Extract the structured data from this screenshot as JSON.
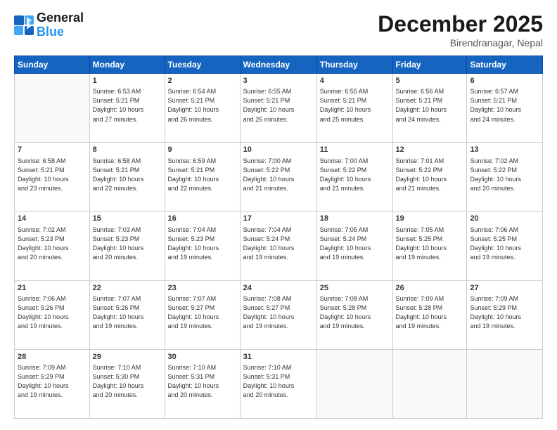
{
  "logo": {
    "line1": "General",
    "line2": "Blue"
  },
  "title": "December 2025",
  "subtitle": "Birendranagar, Nepal",
  "header_days": [
    "Sunday",
    "Monday",
    "Tuesday",
    "Wednesday",
    "Thursday",
    "Friday",
    "Saturday"
  ],
  "weeks": [
    [
      {
        "day": "",
        "info": ""
      },
      {
        "day": "1",
        "info": "Sunrise: 6:53 AM\nSunset: 5:21 PM\nDaylight: 10 hours\nand 27 minutes."
      },
      {
        "day": "2",
        "info": "Sunrise: 6:54 AM\nSunset: 5:21 PM\nDaylight: 10 hours\nand 26 minutes."
      },
      {
        "day": "3",
        "info": "Sunrise: 6:55 AM\nSunset: 5:21 PM\nDaylight: 10 hours\nand 26 minutes."
      },
      {
        "day": "4",
        "info": "Sunrise: 6:55 AM\nSunset: 5:21 PM\nDaylight: 10 hours\nand 25 minutes."
      },
      {
        "day": "5",
        "info": "Sunrise: 6:56 AM\nSunset: 5:21 PM\nDaylight: 10 hours\nand 24 minutes."
      },
      {
        "day": "6",
        "info": "Sunrise: 6:57 AM\nSunset: 5:21 PM\nDaylight: 10 hours\nand 24 minutes."
      }
    ],
    [
      {
        "day": "7",
        "info": "Sunrise: 6:58 AM\nSunset: 5:21 PM\nDaylight: 10 hours\nand 23 minutes."
      },
      {
        "day": "8",
        "info": "Sunrise: 6:58 AM\nSunset: 5:21 PM\nDaylight: 10 hours\nand 22 minutes."
      },
      {
        "day": "9",
        "info": "Sunrise: 6:59 AM\nSunset: 5:21 PM\nDaylight: 10 hours\nand 22 minutes."
      },
      {
        "day": "10",
        "info": "Sunrise: 7:00 AM\nSunset: 5:22 PM\nDaylight: 10 hours\nand 21 minutes."
      },
      {
        "day": "11",
        "info": "Sunrise: 7:00 AM\nSunset: 5:22 PM\nDaylight: 10 hours\nand 21 minutes."
      },
      {
        "day": "12",
        "info": "Sunrise: 7:01 AM\nSunset: 5:22 PM\nDaylight: 10 hours\nand 21 minutes."
      },
      {
        "day": "13",
        "info": "Sunrise: 7:02 AM\nSunset: 5:22 PM\nDaylight: 10 hours\nand 20 minutes."
      }
    ],
    [
      {
        "day": "14",
        "info": "Sunrise: 7:02 AM\nSunset: 5:23 PM\nDaylight: 10 hours\nand 20 minutes."
      },
      {
        "day": "15",
        "info": "Sunrise: 7:03 AM\nSunset: 5:23 PM\nDaylight: 10 hours\nand 20 minutes."
      },
      {
        "day": "16",
        "info": "Sunrise: 7:04 AM\nSunset: 5:23 PM\nDaylight: 10 hours\nand 19 minutes."
      },
      {
        "day": "17",
        "info": "Sunrise: 7:04 AM\nSunset: 5:24 PM\nDaylight: 10 hours\nand 19 minutes."
      },
      {
        "day": "18",
        "info": "Sunrise: 7:05 AM\nSunset: 5:24 PM\nDaylight: 10 hours\nand 19 minutes."
      },
      {
        "day": "19",
        "info": "Sunrise: 7:05 AM\nSunset: 5:25 PM\nDaylight: 10 hours\nand 19 minutes."
      },
      {
        "day": "20",
        "info": "Sunrise: 7:06 AM\nSunset: 5:25 PM\nDaylight: 10 hours\nand 19 minutes."
      }
    ],
    [
      {
        "day": "21",
        "info": "Sunrise: 7:06 AM\nSunset: 5:26 PM\nDaylight: 10 hours\nand 19 minutes."
      },
      {
        "day": "22",
        "info": "Sunrise: 7:07 AM\nSunset: 5:26 PM\nDaylight: 10 hours\nand 19 minutes."
      },
      {
        "day": "23",
        "info": "Sunrise: 7:07 AM\nSunset: 5:27 PM\nDaylight: 10 hours\nand 19 minutes."
      },
      {
        "day": "24",
        "info": "Sunrise: 7:08 AM\nSunset: 5:27 PM\nDaylight: 10 hours\nand 19 minutes."
      },
      {
        "day": "25",
        "info": "Sunrise: 7:08 AM\nSunset: 5:28 PM\nDaylight: 10 hours\nand 19 minutes."
      },
      {
        "day": "26",
        "info": "Sunrise: 7:09 AM\nSunset: 5:28 PM\nDaylight: 10 hours\nand 19 minutes."
      },
      {
        "day": "27",
        "info": "Sunrise: 7:09 AM\nSunset: 5:29 PM\nDaylight: 10 hours\nand 19 minutes."
      }
    ],
    [
      {
        "day": "28",
        "info": "Sunrise: 7:09 AM\nSunset: 5:29 PM\nDaylight: 10 hours\nand 19 minutes."
      },
      {
        "day": "29",
        "info": "Sunrise: 7:10 AM\nSunset: 5:30 PM\nDaylight: 10 hours\nand 20 minutes."
      },
      {
        "day": "30",
        "info": "Sunrise: 7:10 AM\nSunset: 5:31 PM\nDaylight: 10 hours\nand 20 minutes."
      },
      {
        "day": "31",
        "info": "Sunrise: 7:10 AM\nSunset: 5:31 PM\nDaylight: 10 hours\nand 20 minutes."
      },
      {
        "day": "",
        "info": ""
      },
      {
        "day": "",
        "info": ""
      },
      {
        "day": "",
        "info": ""
      }
    ]
  ]
}
